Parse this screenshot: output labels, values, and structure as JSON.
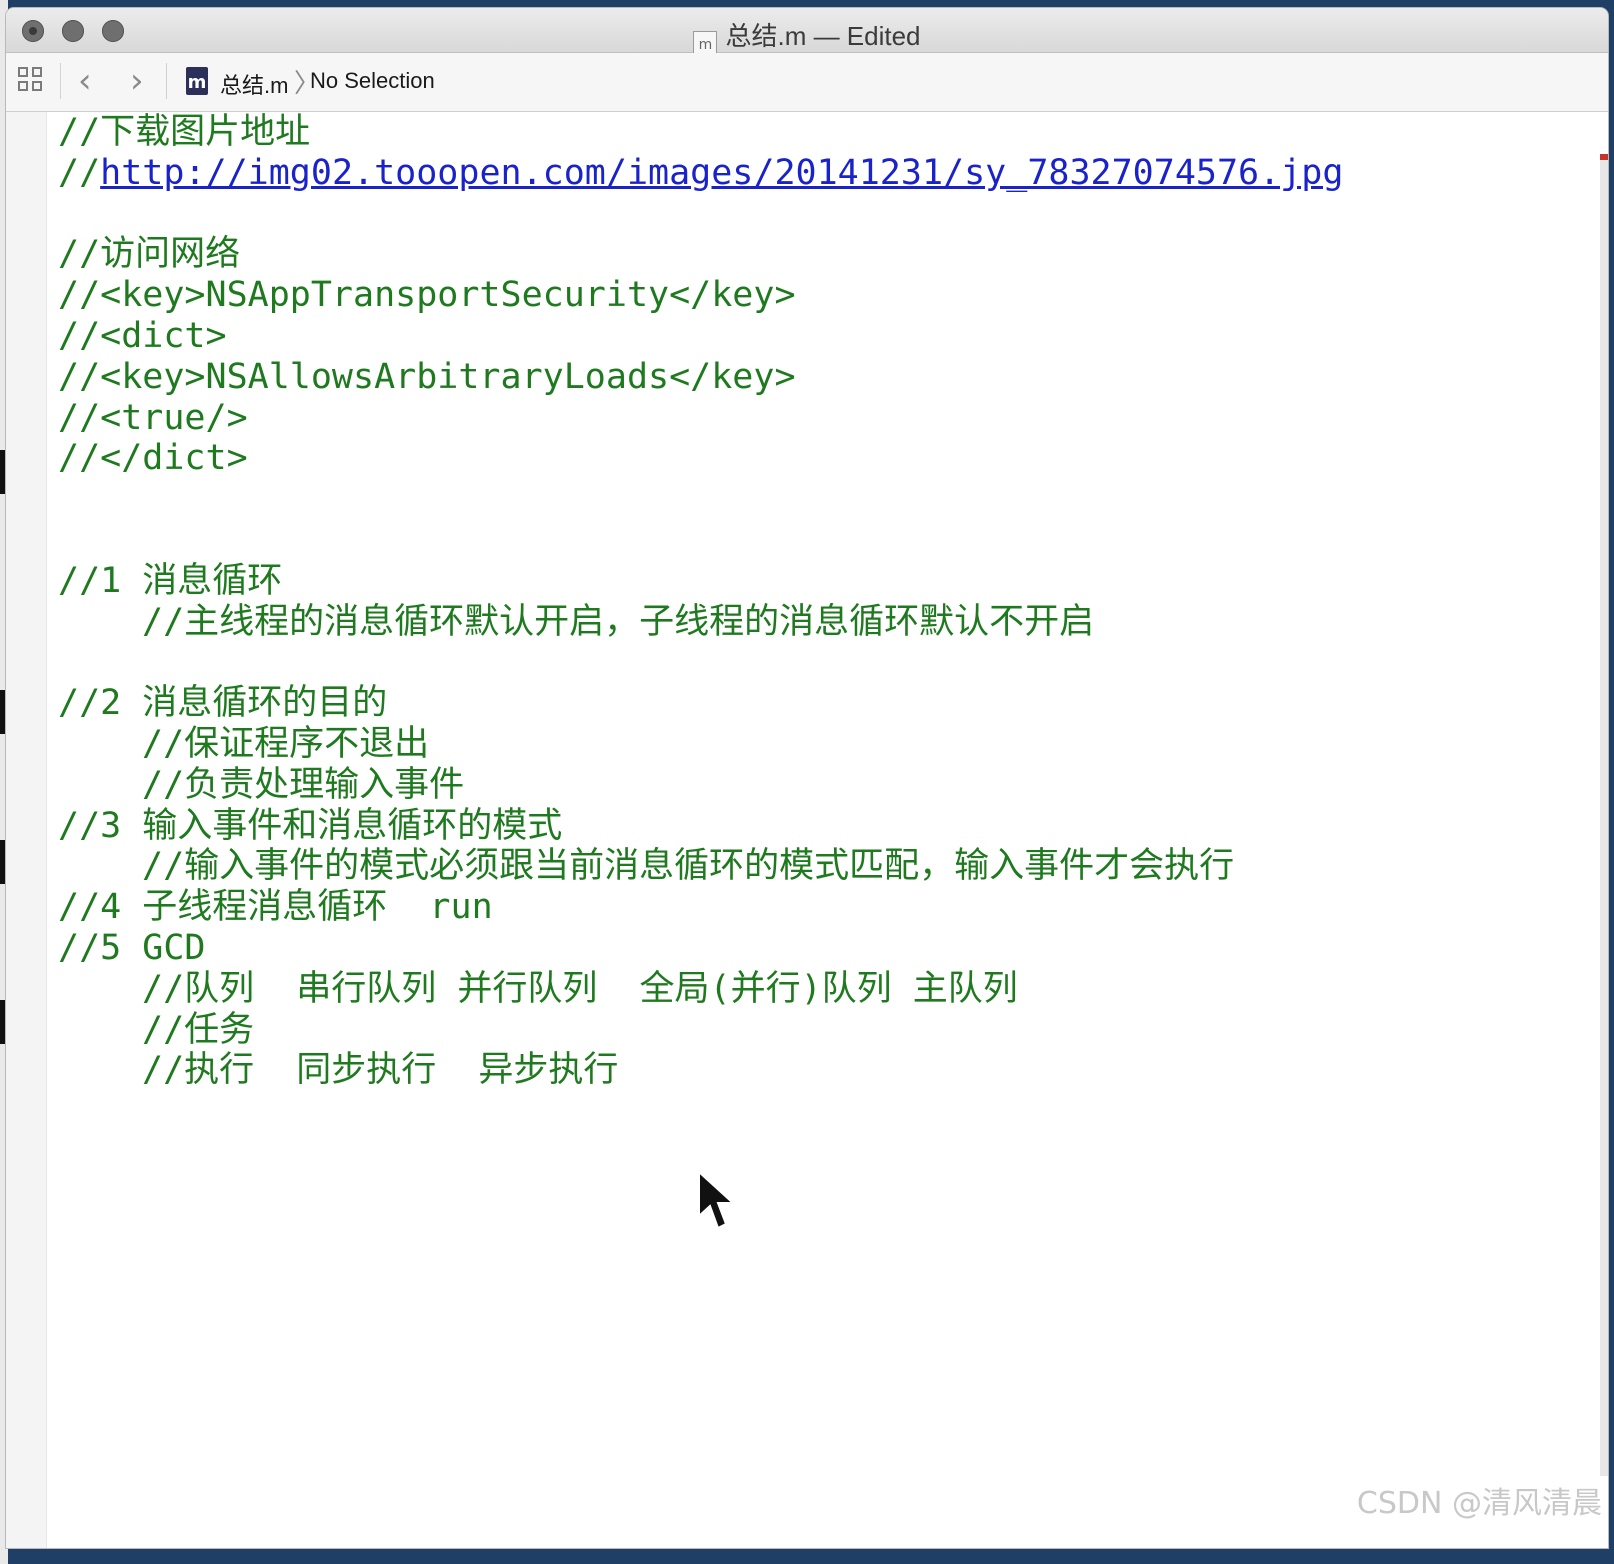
{
  "window": {
    "title": "总结.m — Edited",
    "file_icon": "m"
  },
  "toolbar": {
    "back_icon": "chevron-left-icon",
    "forward_icon": "chevron-right-icon",
    "file_label": "总结.m",
    "file_icon_letter": "m",
    "selection_label": "No Selection"
  },
  "editor": {
    "lines": [
      {
        "text": "//下载图片地址",
        "indent": false
      },
      {
        "prefix": "//",
        "url": "http://img02.tooopen.com/images/20141231/sy_78327074576.jpg"
      },
      {
        "text": "",
        "indent": false
      },
      {
        "text": "//访问网络",
        "indent": false
      },
      {
        "text": "//<key>NSAppTransportSecurity</key>",
        "indent": false
      },
      {
        "text": "//<dict>",
        "indent": false
      },
      {
        "text": "//<key>NSAllowsArbitraryLoads</key>",
        "indent": false
      },
      {
        "text": "//<true/>",
        "indent": false
      },
      {
        "text": "//</dict>",
        "indent": false
      },
      {
        "text": "",
        "indent": false
      },
      {
        "text": "",
        "indent": false
      },
      {
        "text": "//1 消息循环",
        "indent": false
      },
      {
        "text": "//主线程的消息循环默认开启，子线程的消息循环默认不开启",
        "indent": true
      },
      {
        "text": "",
        "indent": false
      },
      {
        "text": "//2 消息循环的目的",
        "indent": false
      },
      {
        "text": "//保证程序不退出",
        "indent": true
      },
      {
        "text": "//负责处理输入事件",
        "indent": true
      },
      {
        "text": "//3 输入事件和消息循环的模式",
        "indent": false
      },
      {
        "text": "//输入事件的模式必须跟当前消息循环的模式匹配，输入事件才会执行",
        "indent": true
      },
      {
        "text": "//4 子线程消息循环  run",
        "indent": false
      },
      {
        "text": "//5 GCD",
        "indent": false
      },
      {
        "text": "//队列  串行队列 并行队列  全局(并行)队列 主队列",
        "indent": true
      },
      {
        "text": "//任务",
        "indent": true
      },
      {
        "text": "//执行  同步执行  异步执行",
        "indent": true
      }
    ]
  },
  "colors": {
    "comment": "#1f7a1f",
    "link": "#1a23c9"
  },
  "watermark": "CSDN @清风清晨"
}
